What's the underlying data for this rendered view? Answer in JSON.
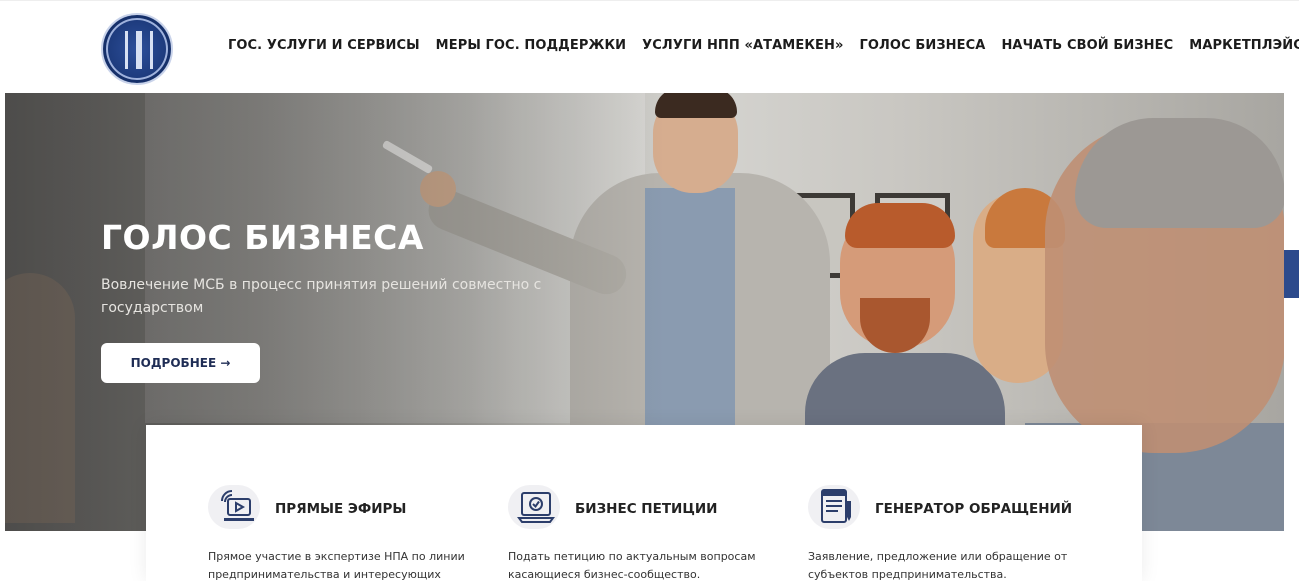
{
  "header": {
    "logo_icon": "emblem-logo",
    "nav": [
      {
        "label": "ГОС. УСЛУГИ И СЕРВИСЫ"
      },
      {
        "label": "МЕРЫ ГОС. ПОДДЕРЖКИ"
      },
      {
        "label": "УСЛУГИ НПП «АТАМЕКЕН»"
      },
      {
        "label": "ГОЛОС БИЗНЕСА"
      },
      {
        "label": "НАЧАТЬ СВОЙ БИЗНЕС"
      },
      {
        "label": "МАРКЕТПЛЭЙС"
      }
    ]
  },
  "hero": {
    "title": "ГОЛОС БИЗНЕСА",
    "subtitle": "Вовлечение МСБ в процесс принятия решений совместно с государством",
    "button_label": "ПОДРОБНЕЕ →"
  },
  "cards": [
    {
      "icon": "live-stream-icon",
      "title": "ПРЯМЫЕ ЭФИРЫ",
      "text": "Прямое участие в экспертизе НПА по линии предпринимательства и интересующих"
    },
    {
      "icon": "laptop-check-icon",
      "title": "БИЗНЕС ПЕТИЦИИ",
      "text": "Подать петицию по актуальным вопросам касающиеся бизнес-сообщество."
    },
    {
      "icon": "document-pen-icon",
      "title": "ГЕНЕРАТОР ОБРАЩЕНИЙ",
      "text": "Заявление, предложение или обращение от субъектов предпринимательства."
    }
  ],
  "colors": {
    "accent_blue": "#2c4a8c",
    "button_text": "#1f2d55",
    "hero_title": "#ffffff"
  }
}
